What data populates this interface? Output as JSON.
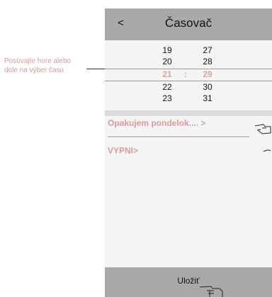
{
  "annotation": {
    "line1": "Posúvajte hore alebo",
    "line2": "dole na výber času"
  },
  "header": {
    "back_label": "<",
    "title": "Časovač"
  },
  "picker": {
    "rows": [
      {
        "hour": "19",
        "minute": "27"
      },
      {
        "hour": "20",
        "minute": "28"
      },
      {
        "hour": "21",
        "minute": "29",
        "selected": true
      },
      {
        "hour": "22",
        "minute": "30"
      },
      {
        "hour": "23",
        "minute": "31"
      }
    ],
    "separator": ":"
  },
  "repeat": {
    "label": "Opakujem pondelok.... >"
  },
  "off": {
    "label": "VYPNI>"
  },
  "footer": {
    "save_label": "Uložiť"
  },
  "icons": [
    "back-icon",
    "hand-pointer-icon"
  ],
  "colors": {
    "header_bg": "#a9a9a9",
    "accent_pink": "#d79c9c",
    "annotation_text": "#d99a9a"
  }
}
